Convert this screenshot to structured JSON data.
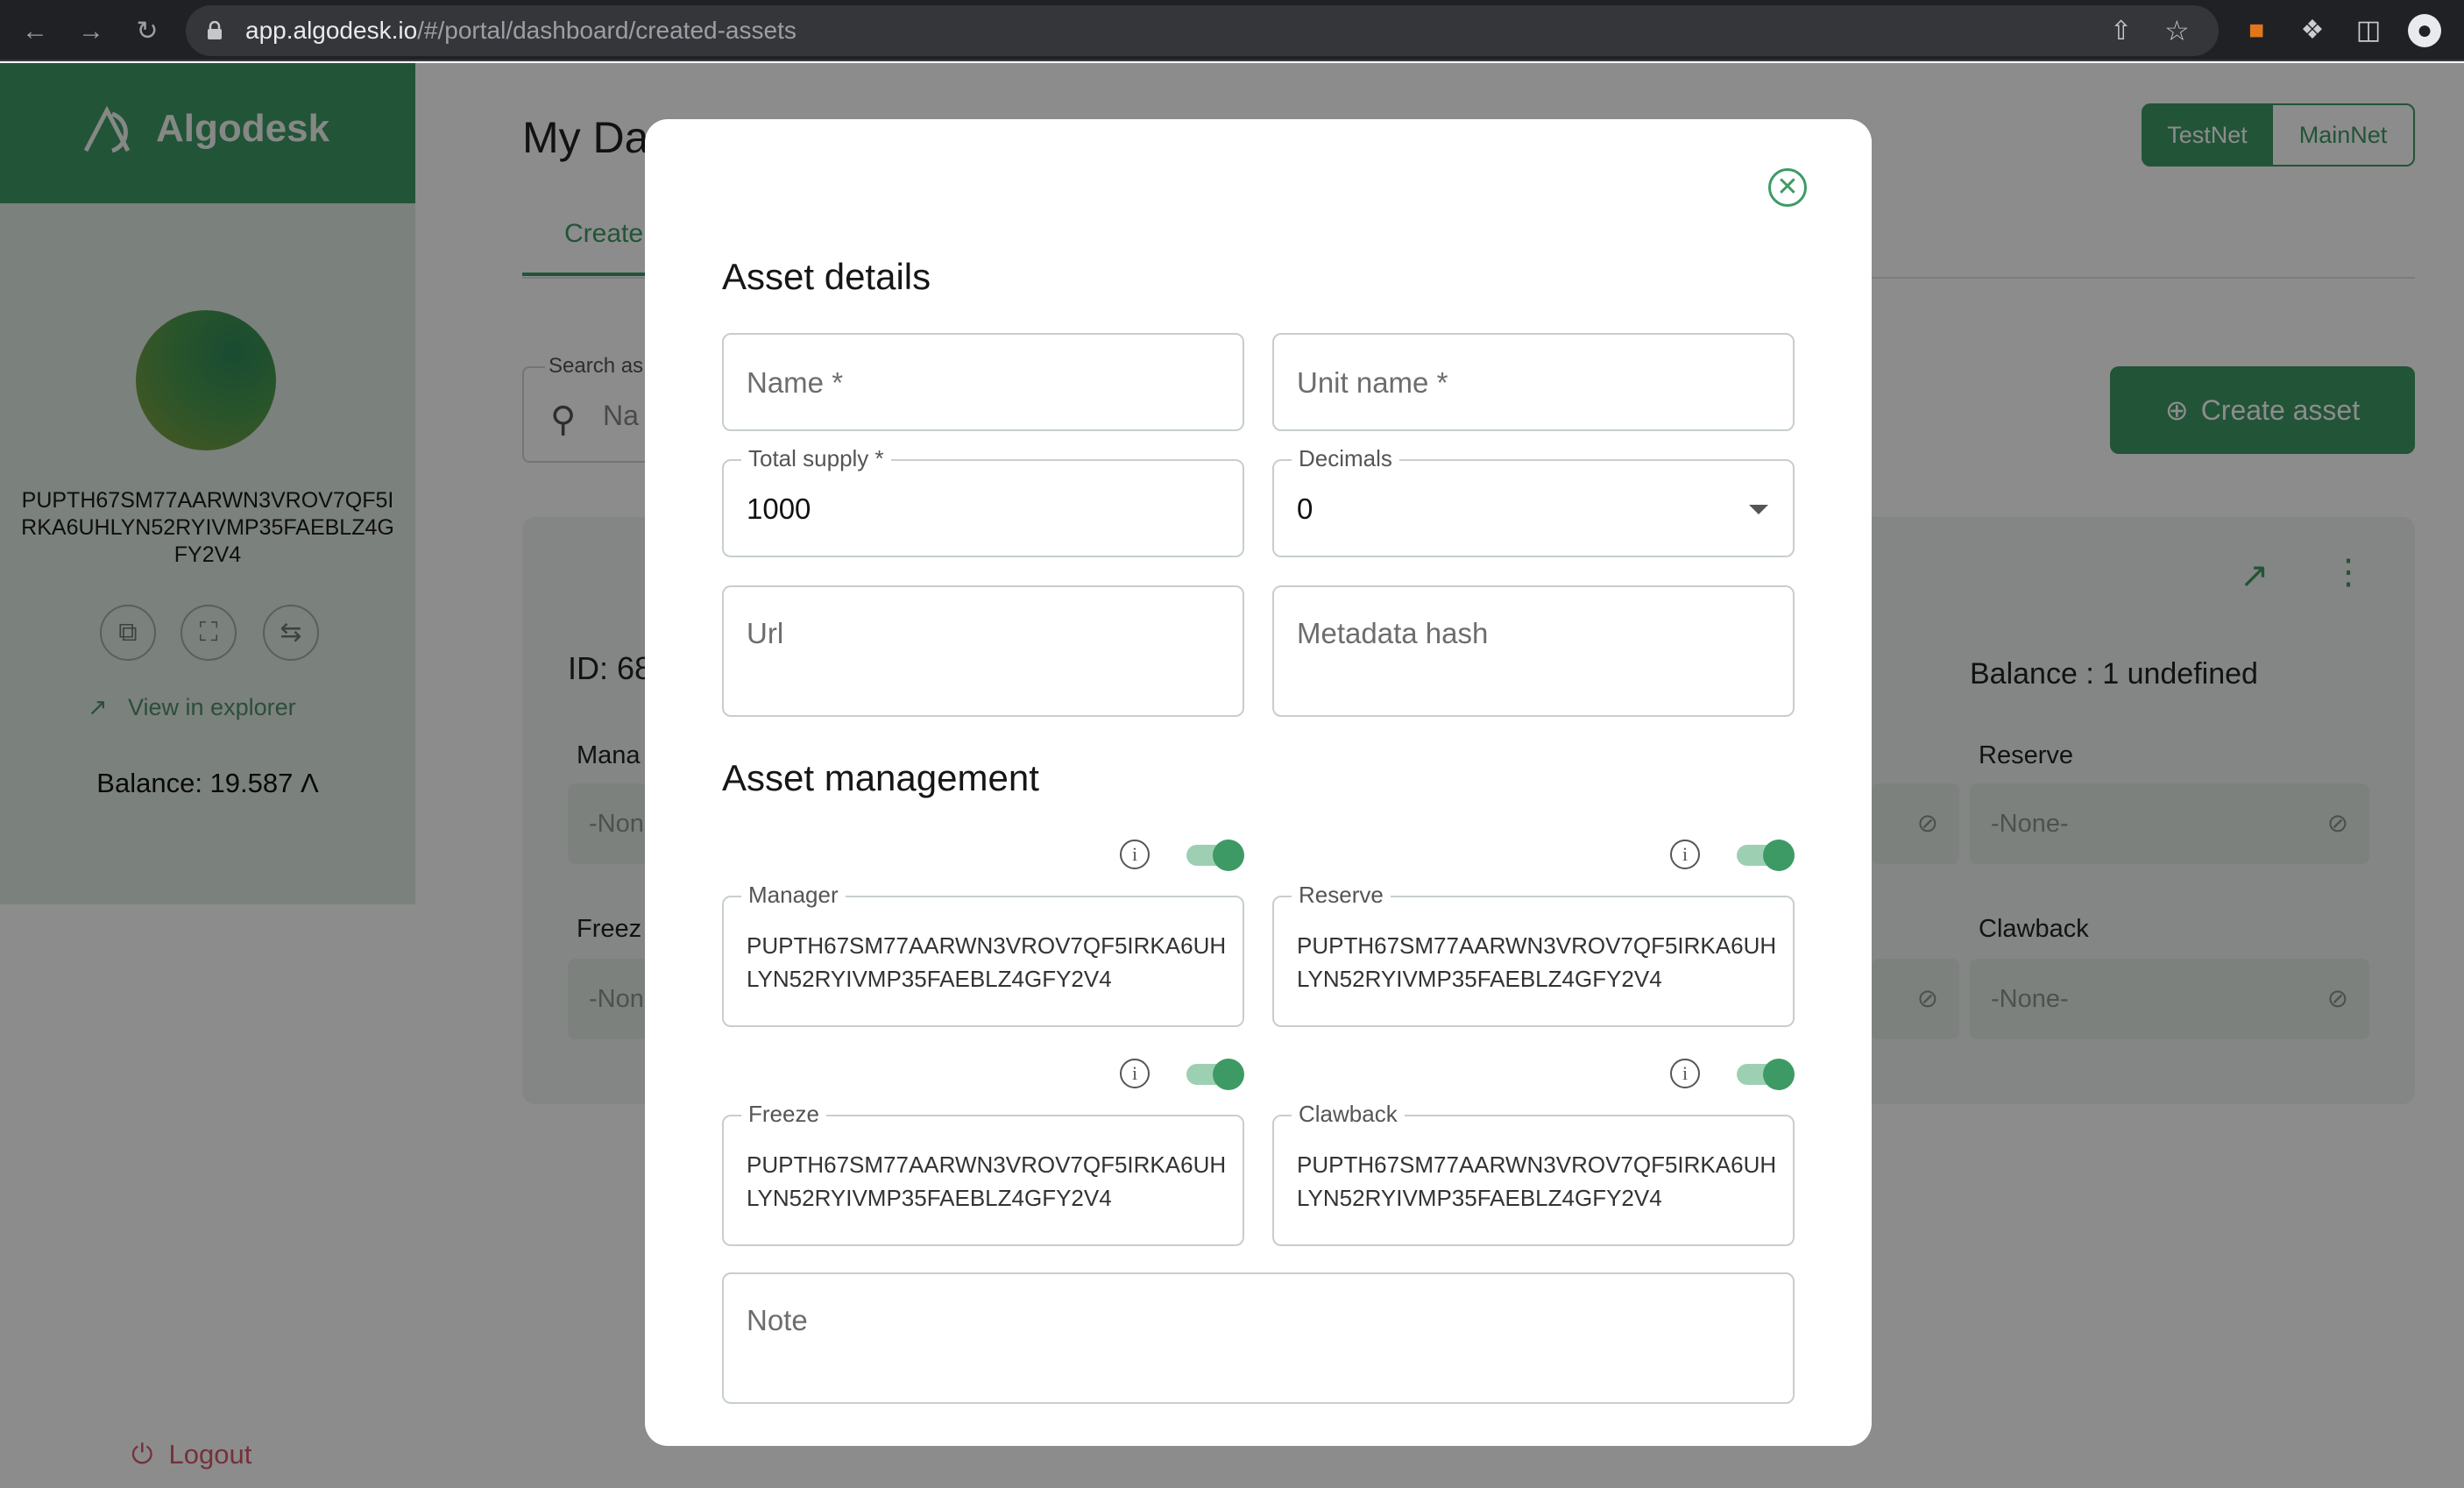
{
  "browser": {
    "url_host": "app.algodesk.io",
    "url_path": "/#/portal/dashboard/created-assets"
  },
  "sidebar": {
    "brand_name": "Algodesk",
    "account_address": "PUPTH67SM77AARWN3VROV7QF5IRKA6UHLYN52RYIVMP35FAEBLZ4GFY2V4",
    "view_in_explorer": "View in explorer",
    "balance": "Balance: 19.587 Ʌ",
    "logout": "Logout"
  },
  "header": {
    "title": "My Da",
    "networks": [
      "TestNet",
      "MainNet"
    ],
    "active_network": "TestNet"
  },
  "tabs": {
    "created": "Create"
  },
  "search": {
    "label": "Search as",
    "placeholder": "Na"
  },
  "create_asset_button": "Create asset",
  "asset_card": {
    "id": "ID: 68",
    "balance": "Balance : 1 undefined",
    "labels": {
      "manager": "Mana",
      "reserve": "Reserve",
      "freeze": "Freez",
      "clawback": "Clawback"
    },
    "none_value": "-None-",
    "none_value_cut": "-Non"
  },
  "modal": {
    "asset_details_heading": "Asset details",
    "name_placeholder": "Name *",
    "unit_name_placeholder": "Unit name *",
    "total_supply_label": "Total supply *",
    "total_supply_value": "1000",
    "decimals_label": "Decimals",
    "decimals_value": "0",
    "url_placeholder": "Url",
    "metadata_hash_placeholder": "Metadata hash",
    "asset_management_heading": "Asset management",
    "manager_label": "Manager",
    "manager_value": "PUPTH67SM77AARWN3VROV7QF5IRKA6UHLYN52RYIVMP35FAEBLZ4GFY2V4",
    "reserve_label": "Reserve",
    "reserve_value": "PUPTH67SM77AARWN3VROV7QF5IRKA6UHLYN52RYIVMP35FAEBLZ4GFY2V4",
    "freeze_label": "Freeze",
    "freeze_value": "PUPTH67SM77AARWN3VROV7QF5IRKA6UHLYN52RYIVMP35FAEBLZ4GFY2V4",
    "clawback_label": "Clawback",
    "clawback_value": "PUPTH67SM77AARWN3VROV7QF5IRKA6UHLYN52RYIVMP35FAEBLZ4GFY2V4",
    "note_placeholder": "Note",
    "toggles_enabled": true
  },
  "colors": {
    "brand": "#3e9a65",
    "logout": "#d25b6b"
  },
  "icons": [
    "back-icon",
    "forward-icon",
    "reload-icon",
    "lock-icon",
    "share-icon",
    "star-icon",
    "fox-icon",
    "puzzle-icon",
    "sidepanel-icon",
    "profile-icon",
    "copy-icon",
    "qr-icon",
    "switch-icon",
    "external-link-icon",
    "power-icon",
    "search-icon",
    "plus-circle-icon",
    "more-vertical-icon",
    "close-circle-icon",
    "info-icon",
    "block-icon",
    "caret-down-icon"
  ]
}
